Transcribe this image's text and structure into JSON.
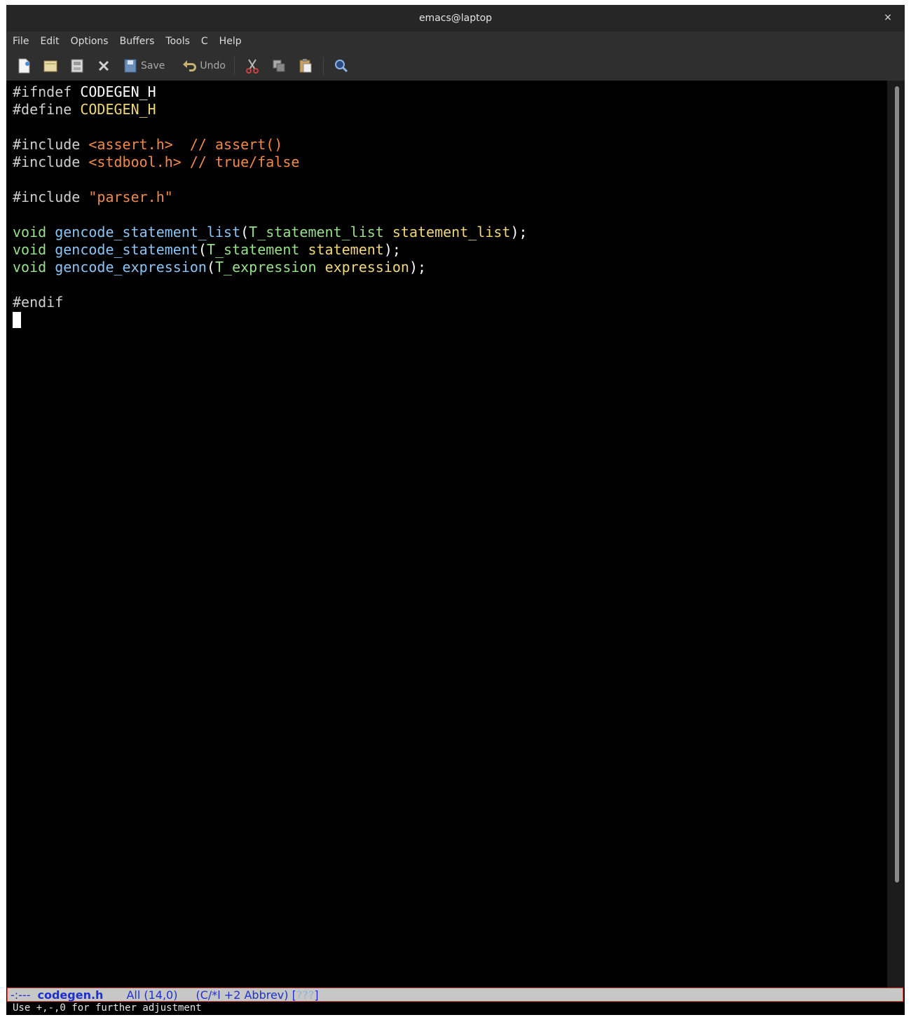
{
  "window": {
    "title": "emacs@laptop",
    "close_glyph": "×"
  },
  "menubar": {
    "items": [
      "File",
      "Edit",
      "Options",
      "Buffers",
      "Tools",
      "C",
      "Help"
    ]
  },
  "toolbar": {
    "new_file": "new-file-icon",
    "open_dir": "open-folder-icon",
    "open_file": "open-file-icon",
    "close": "close-icon",
    "save_label": "Save",
    "undo_label": "Undo",
    "cut": "cut-icon",
    "copy": "copy-icon",
    "paste": "paste-icon",
    "search": "search-icon"
  },
  "code": {
    "lines": [
      [
        {
          "t": "#ifndef ",
          "c": "pp"
        },
        {
          "t": "CODEGEN_H",
          "c": "wh"
        }
      ],
      [
        {
          "t": "#define ",
          "c": "pp"
        },
        {
          "t": "CODEGEN_H",
          "c": "mac"
        }
      ],
      [],
      [
        {
          "t": "#include ",
          "c": "pp"
        },
        {
          "t": "<assert.h>",
          "c": "str"
        },
        {
          "t": "  ",
          "c": "pp"
        },
        {
          "t": "// assert()",
          "c": "str"
        }
      ],
      [
        {
          "t": "#include ",
          "c": "pp"
        },
        {
          "t": "<stdbool.h>",
          "c": "str"
        },
        {
          "t": " ",
          "c": "pp"
        },
        {
          "t": "// true/false",
          "c": "str"
        }
      ],
      [],
      [
        {
          "t": "#include ",
          "c": "pp"
        },
        {
          "t": "\"parser.h\"",
          "c": "str"
        }
      ],
      [],
      [
        {
          "t": "void",
          "c": "kw"
        },
        {
          "t": " ",
          "c": "pp"
        },
        {
          "t": "gencode_statement_list",
          "c": "fn"
        },
        {
          "t": "(",
          "c": "wh"
        },
        {
          "t": "T_statement_list",
          "c": "ty"
        },
        {
          "t": " ",
          "c": "pp"
        },
        {
          "t": "statement_list",
          "c": "var"
        },
        {
          "t": ");",
          "c": "wh"
        }
      ],
      [
        {
          "t": "void",
          "c": "kw"
        },
        {
          "t": " ",
          "c": "pp"
        },
        {
          "t": "gencode_statement",
          "c": "fn"
        },
        {
          "t": "(",
          "c": "wh"
        },
        {
          "t": "T_statement",
          "c": "ty"
        },
        {
          "t": " ",
          "c": "pp"
        },
        {
          "t": "statement",
          "c": "var"
        },
        {
          "t": ");",
          "c": "wh"
        }
      ],
      [
        {
          "t": "void",
          "c": "kw"
        },
        {
          "t": " ",
          "c": "pp"
        },
        {
          "t": "gencode_expression",
          "c": "fn"
        },
        {
          "t": "(",
          "c": "wh"
        },
        {
          "t": "T_expression",
          "c": "ty"
        },
        {
          "t": " ",
          "c": "pp"
        },
        {
          "t": "expression",
          "c": "var"
        },
        {
          "t": ");",
          "c": "wh"
        }
      ],
      [],
      [
        {
          "t": "#endif",
          "c": "pp"
        }
      ]
    ]
  },
  "modeline": {
    "status": "-:---",
    "buffer": "codegen.h",
    "position": "All (14,0)",
    "mode": "(C/*l +2 Abbrev) [",
    "extra": "???",
    "close_bracket": "]"
  },
  "echo_area": {
    "message": "Use +,-,0 for further adjustment"
  },
  "colors": {
    "preprocessor": "#cfcfcf",
    "string": "#f08a4b",
    "keyword": "#98e08a",
    "function": "#8cc4f4",
    "variable": "#f0d77a",
    "modeline_text": "#1f2fd0"
  }
}
